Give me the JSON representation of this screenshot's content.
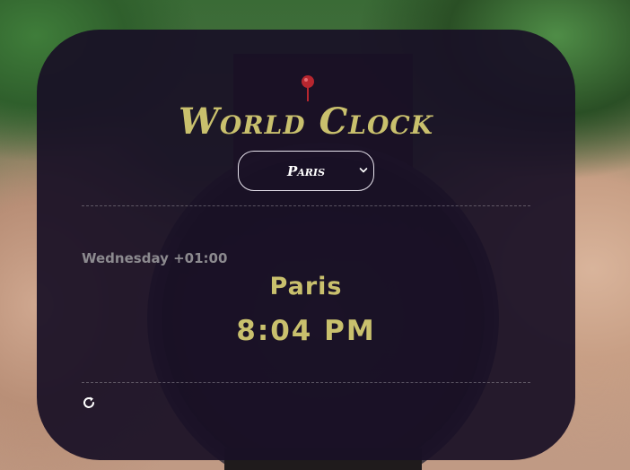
{
  "app": {
    "title": "World Clock"
  },
  "selector": {
    "selected_city": "Paris"
  },
  "clock": {
    "day_offset": "Wednesday +01:00",
    "city": "Paris",
    "time": "8:04 PM"
  },
  "icons": {
    "pin": "map-pin-icon",
    "refresh": "refresh-icon",
    "dropdown": "chevron-down-icon"
  },
  "colors": {
    "accent": "#c9c06d",
    "card_bg": "#191026",
    "muted_text": "#8c8a8f",
    "pin": "#b7262f"
  }
}
